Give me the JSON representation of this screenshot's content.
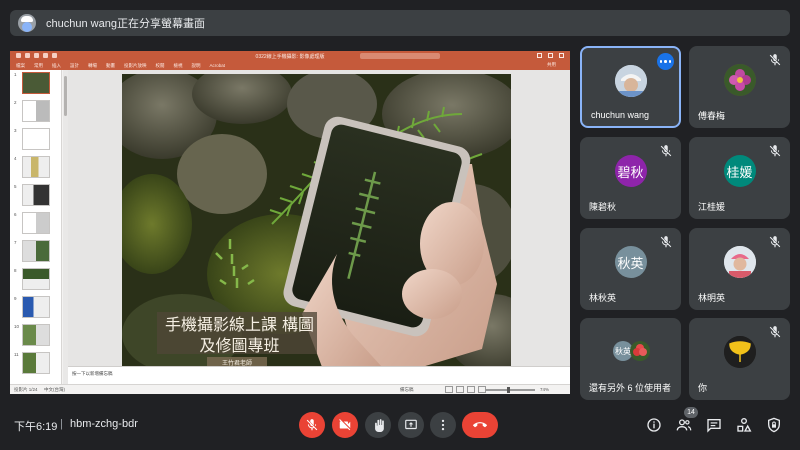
{
  "presenter_bar": {
    "text": "chuchun wang正在分享螢幕畫面"
  },
  "presentation": {
    "window_title": "0322線上手機攝影: 影像處理版",
    "ribbon_tabs": [
      "檔案",
      "常用",
      "插入",
      "設計",
      "轉場",
      "動畫",
      "投影片放映",
      "校閱",
      "檢視",
      "說明",
      "Acrobat"
    ],
    "share_label": "共用",
    "slide_numbers": [
      "1",
      "2",
      "3",
      "4",
      "5",
      "6",
      "7",
      "8",
      "9",
      "10",
      "11"
    ],
    "slide_title": "手機攝影線上課 構圖及修圖專班",
    "slide_teacher": "王竹君老師",
    "notes_placeholder": "按一下以新增備忘稿",
    "status_slide": "投影片 1/24",
    "status_lang": "中文(台灣)",
    "status_notes": "備忘稿",
    "zoom_level": "74%"
  },
  "participants": [
    {
      "name": "chuchun wang",
      "type": "photo",
      "active": true
    },
    {
      "name": "傅春梅",
      "type": "flower"
    },
    {
      "name": "陳碧秋",
      "initials": "碧秋",
      "color": "#8e24aa"
    },
    {
      "name": "江桂媛",
      "initials": "桂媛",
      "color": "#00897b"
    },
    {
      "name": "林秋英",
      "initials": "秋英",
      "color": "#78909c"
    },
    {
      "name": "林明英",
      "type": "photo2"
    },
    {
      "name": "還有另外 6 位使用者",
      "initials": "秋英",
      "color": "#78909c"
    },
    {
      "name": "你",
      "type": "ginkgo"
    }
  ],
  "bottom_bar": {
    "time": "下午6:19",
    "separator": "|",
    "meeting_code": "hbm-zchg-bdr",
    "people_count": "14"
  },
  "colors": {
    "accent": "#8ab4f8",
    "danger": "#ea4335",
    "tile": "#3c4043",
    "background": "#202124",
    "ppt_accent": "#c55a3b"
  }
}
